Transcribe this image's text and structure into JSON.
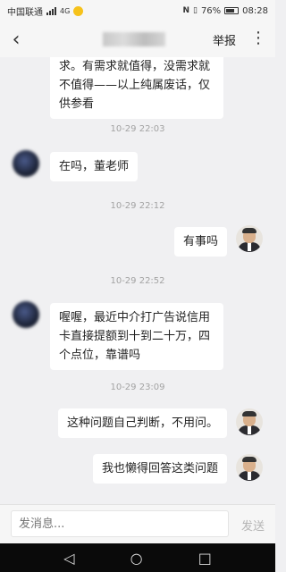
{
  "status_bar": {
    "carrier": "中国联通",
    "network": "4G",
    "battery": "76%",
    "time": "08:28"
  },
  "header": {
    "back_icon": "‹",
    "report_label": "举报",
    "more_icon": "⋮"
  },
  "messages": {
    "m1": {
      "text": "求。有需求就值得，没需求就不值得——以上纯属废话，仅供参看"
    },
    "t1": "10-29 22:03",
    "m2": {
      "text": "在吗，董老师"
    },
    "t2": "10-29 22:12",
    "m3": {
      "text": "有事吗"
    },
    "t3": "10-29 22:52",
    "m4": {
      "text": "喔喔，最近中介打广告说信用卡直接提额到十到二十万，四个点位，靠谱吗"
    },
    "t4": "10-29 23:09",
    "m5": {
      "text": "这种问题自己判断，不用问。"
    },
    "m6": {
      "text": "我也懒得回答这类问题"
    }
  },
  "input": {
    "placeholder": "发消息...",
    "send_label": "发送"
  },
  "android_nav": {
    "back": "◁",
    "home": "○",
    "recent": "□"
  }
}
